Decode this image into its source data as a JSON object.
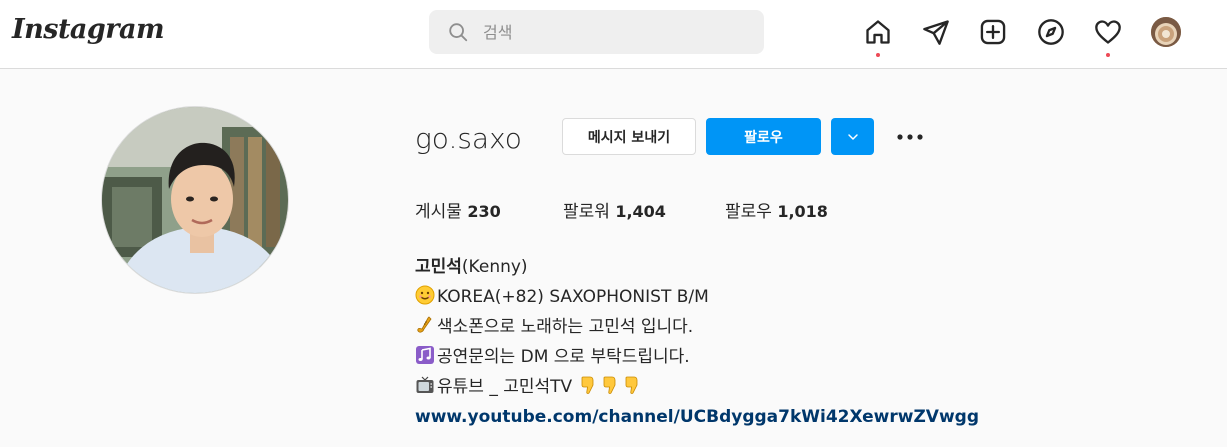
{
  "header": {
    "logo": "Instagram",
    "search_placeholder": "검색",
    "icons": [
      "home-icon",
      "direct-message-icon",
      "new-post-icon",
      "explore-icon",
      "activity-heart-icon"
    ],
    "accent_dot_color": "#ed4956"
  },
  "profile": {
    "username": "go.saxo",
    "message_button": "메시지 보내기",
    "follow_button": "팔로우",
    "stats": {
      "posts_label": "게시물",
      "posts_count": "230",
      "followers_label": "팔로워",
      "followers_count": "1,404",
      "following_label": "팔로우",
      "following_count": "1,018"
    },
    "bio": {
      "name": "고민석",
      "name_suffix": "(Kenny)",
      "lines": [
        "KOREA(+82) SAXOPHONIST B/M",
        "색소폰으로 노래하는 고민석 입니다.",
        "공연문의는 DM 으로 부탁드립니다.",
        "유튜브 _ 고민석TV "
      ],
      "link": "www.youtube.com/channel/UCBdygga7kWi42XewrwZVwgg"
    }
  },
  "colors": {
    "primary_blue": "#0095f6",
    "link_color": "#00376b",
    "border": "#dbdbdb"
  }
}
